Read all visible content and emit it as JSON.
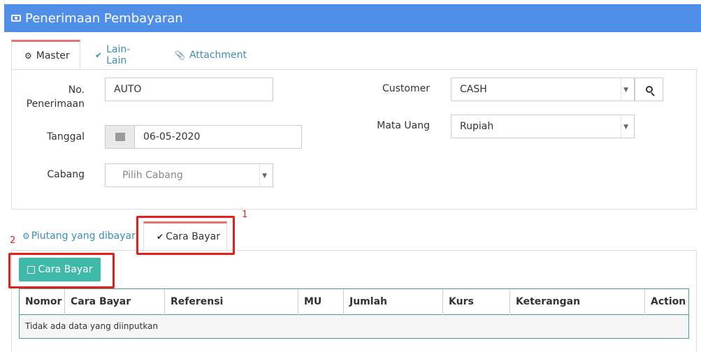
{
  "header": {
    "title": "Penerimaan Pembayaran",
    "icon": "money-icon"
  },
  "top_tabs": [
    {
      "label": "Master",
      "icon": "cogs-icon"
    },
    {
      "label": "Lain-Lain",
      "icon": "check-circle-icon"
    },
    {
      "label": "Attachment",
      "icon": "paperclip-icon"
    }
  ],
  "form": {
    "no_label": "No. Penerimaan",
    "no_value": "AUTO",
    "tanggal_label": "Tanggal",
    "tanggal_value": "06-05-2020",
    "cabang_label": "Cabang",
    "cabang_placeholder": "Pilih Cabang",
    "customer_label": "Customer",
    "customer_value": "CASH",
    "mata_uang_label": "Mata Uang",
    "mata_uang_value": "Rupiah"
  },
  "bottom_tabs": [
    {
      "label": "Piutang yang dibayar",
      "icon": "cogs-icon"
    },
    {
      "label": "Cara Bayar",
      "icon": "check-circle-icon"
    }
  ],
  "annotations": {
    "marker_1": "1",
    "marker_2": "2",
    "color": "#e81e1e"
  },
  "cara_bayar_button": {
    "label": "Cara Bayar",
    "icon": "copy-icon",
    "color": "#3fb9a8"
  },
  "table": {
    "columns": [
      "Nomor",
      "Cara Bayar",
      "Referensi",
      "MU",
      "Jumlah",
      "Kurs",
      "Keterangan",
      "Action"
    ],
    "empty_text": "Tidak ada data yang diinputkan"
  },
  "colors": {
    "header": "#4f8fe8",
    "tab_active_border": "#e87272",
    "link": "#3c8dbc"
  }
}
